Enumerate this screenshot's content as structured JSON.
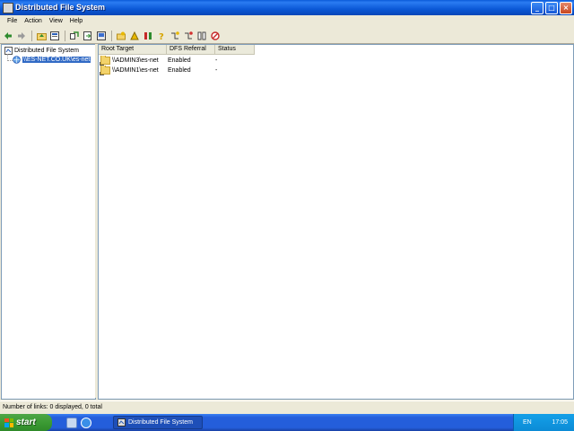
{
  "window": {
    "title": "Distributed File System",
    "controls": [
      "_",
      "□",
      "×"
    ]
  },
  "menu": [
    "File",
    "Action",
    "View",
    "Help"
  ],
  "toolbar": {
    "icons": [
      "back-icon",
      "forward-icon",
      "up-icon",
      "properties-icon",
      "refresh-icon",
      "export-icon",
      "connect-icon",
      "new-root-icon",
      "new-link-icon",
      "delete-icon",
      "help-icon",
      "add-target-icon",
      "check-status-icon",
      "tile-icon",
      "stop-icon"
    ]
  },
  "tree": {
    "root_label": "Distributed File System",
    "child_label": "\\\\ES-NET.CO.UK\\es-net"
  },
  "list": {
    "columns": [
      "Root Target",
      "DFS Referral",
      "Status"
    ],
    "rows": [
      {
        "target": "\\\\ADMIN3\\es-net",
        "referral": "Enabled",
        "status": "-"
      },
      {
        "target": "\\\\ADMIN1\\es-net",
        "referral": "Enabled",
        "status": "-"
      }
    ]
  },
  "status_bar": "Number of links: 0 displayed, 0 total",
  "taskbar": {
    "start_label": "start",
    "task_button_label": "Distributed File System",
    "language": "EN",
    "clock": "17:05"
  },
  "colors": {
    "titlebar": "#0b58d6",
    "selection": "#316ac5",
    "start_button": "#3c9b34",
    "tray": "#0c8bd6"
  }
}
